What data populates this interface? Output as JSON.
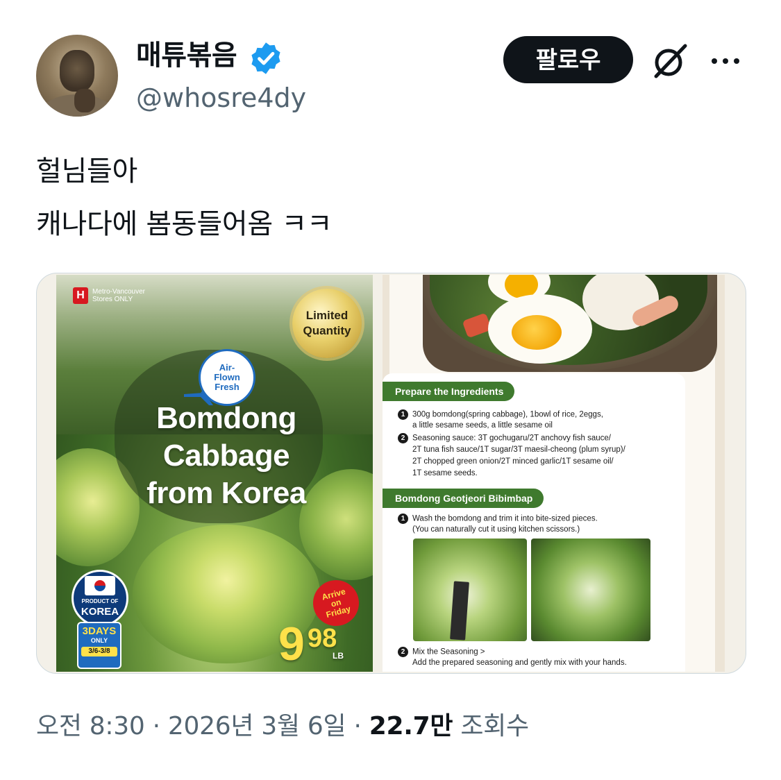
{
  "user": {
    "display_name": "매튜볶음",
    "handle": "@whosre4dy",
    "verified_icon": "verified-badge-icon",
    "avatar_icon": "avatar-image"
  },
  "header": {
    "follow_label": "팔로우",
    "grok_icon": "grok-icon",
    "more_icon": "more-icon"
  },
  "tweet": {
    "lines": [
      "헐님들아",
      "캐나다에 봄동들어옴 ㅋㅋ"
    ]
  },
  "media": {
    "flyer": {
      "store_note_1": "Metro-Vancouver",
      "store_note_2": "Stores ONLY",
      "limited_1": "Limited",
      "limited_2": "Quantity",
      "airflown_1": "Air-",
      "airflown_2": "Flown",
      "airflown_3": "Fresh",
      "title_1": "Bomdong",
      "title_2": "Cabbage",
      "title_3": "from Korea",
      "product_of": "PRODUCT OF",
      "korea": "KOREA",
      "days": "3DAYS",
      "only": "ONLY",
      "dates": "3/6-3/8",
      "arrive_1": "Arrive",
      "arrive_2": "on",
      "arrive_3": "Friday",
      "price_dollar": "9",
      "price_cents": "98",
      "price_unit": "LB"
    },
    "recipe": {
      "section1": "Prepare the Ingredients",
      "i1_num": "1",
      "i1_a": "300g bomdong(spring cabbage), 1bowl of rice, 2eggs,",
      "i1_b": "a little sesame seeds, a little sesame oil",
      "i2_num": "2",
      "i2_a": "Seasoning sauce: 3T gochugaru/2T anchovy fish sauce/",
      "i2_b": "2T tuna fish sauce/1T sugar/3T maesil-cheong (plum syrup)/",
      "i2_c": "2T chopped green onion/2T minced garlic/1T sesame oil/",
      "i2_d": "1T sesame seeds.",
      "section2": "Bomdong Geotjeori Bibimbap",
      "s1_num": "1",
      "s1_a": "Wash the bomdong and trim it into bite-sized pieces.",
      "s1_b": "(You can naturally cut it using kitchen scissors.)",
      "s2_num": "2",
      "s2_a": "Mix the Seasoning >",
      "s2_b": "Add the prepared seasoning and gently mix with your hands."
    }
  },
  "footer": {
    "time": "오전 8:30",
    "sep1": "·",
    "date": "2026년 3월 6일",
    "sep2": "·",
    "views": "22.7만",
    "views_label": "조회수"
  }
}
